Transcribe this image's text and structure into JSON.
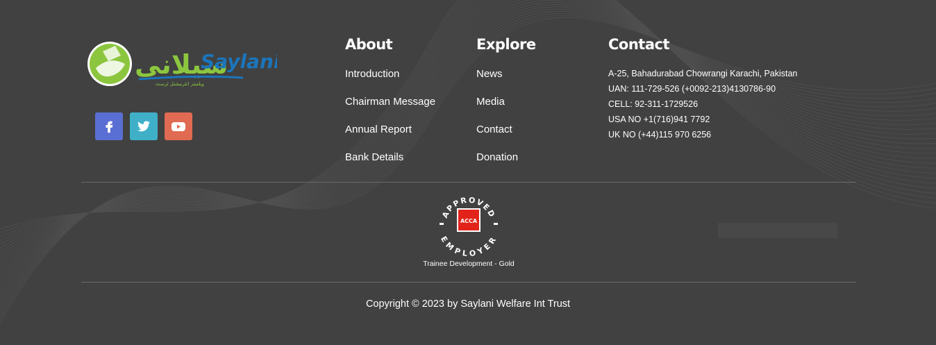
{
  "logo": {
    "urdu_text": "سیلانی",
    "latin_text": "Saylani",
    "tagline": "ویلفیئر انٹرنیشنل ٹرسٹ"
  },
  "social": [
    {
      "name": "facebook",
      "icon": "facebook-icon",
      "color": "#5a6fd3"
    },
    {
      "name": "twitter",
      "icon": "twitter-icon",
      "color": "#3fb0c8"
    },
    {
      "name": "youtube",
      "icon": "youtube-icon",
      "color": "#e06a52"
    }
  ],
  "about": {
    "title": "About",
    "links": [
      "Introduction",
      "Chairman Message",
      "Annual Report",
      "Bank Details"
    ]
  },
  "explore": {
    "title": "Explore",
    "links": [
      "News",
      "Media",
      "Contact",
      "Donation"
    ]
  },
  "contact": {
    "title": "Contact",
    "lines": [
      "A-25, Bahadurabad Chowrangi Karachi, Pakistan",
      "UAN: 111-729-526 (+0092-213)4130786-90",
      "CELL: 92-311-1729526",
      "USA NO +1(716)941 7792",
      "UK NO (+44)115 970 6256"
    ]
  },
  "badge": {
    "top_text": "APPROVED",
    "bottom_text": "EMPLOYER",
    "center_text": "ACCA",
    "caption": "Trainee Development - Gold"
  },
  "copyright": "Copyright © 2023 by Saylani Welfare Int Trust",
  "colors": {
    "background": "#414141",
    "acca_red": "#e2231a",
    "logo_green": "#8cc63f",
    "logo_blue": "#1b75bc"
  }
}
